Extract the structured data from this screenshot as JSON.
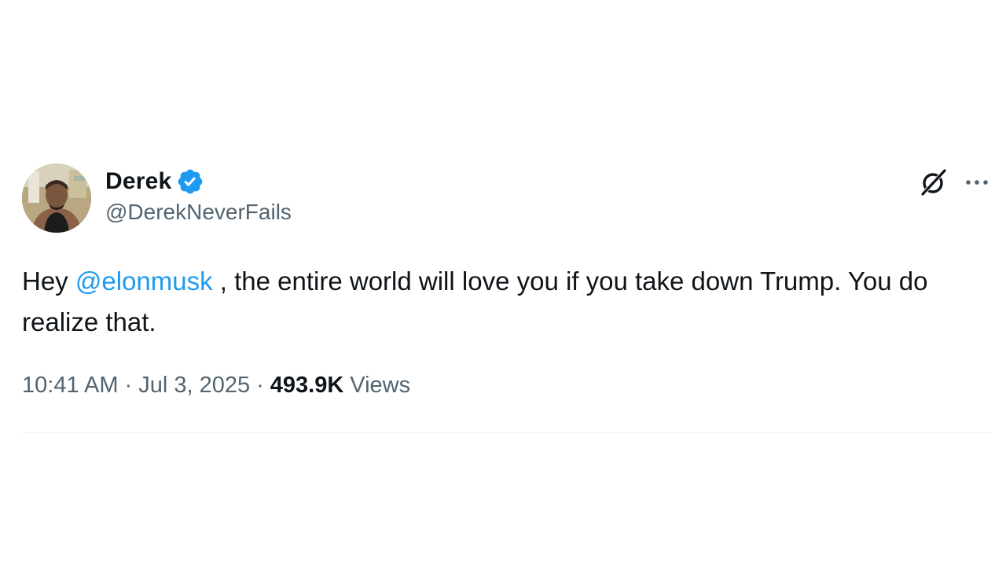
{
  "author": {
    "display_name": "Derek",
    "handle": "@DerekNeverFails"
  },
  "tweet": {
    "text_prefix": "Hey ",
    "mention": "@elonmusk",
    "text_suffix": " , the entire world will love you if you take down Trump. You do realize that."
  },
  "meta": {
    "time": "10:41 AM",
    "separator": "·",
    "date": "Jul 3, 2025",
    "views_count": "493.9K",
    "views_label": "Views"
  },
  "icons": {
    "verified": "verified-badge-icon",
    "grok": "grok-icon",
    "more": "more-options-icon"
  },
  "colors": {
    "accent": "#1d9bf0",
    "text": "#0f1419",
    "secondary_text": "#536471",
    "divider": "#eff3f4"
  }
}
